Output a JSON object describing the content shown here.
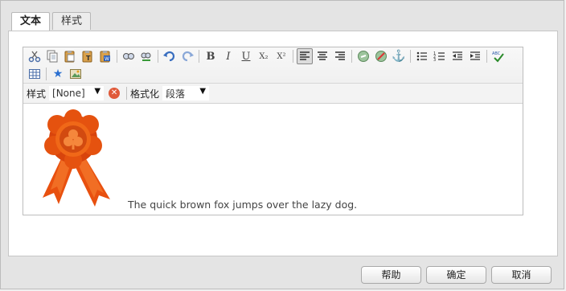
{
  "tabs": [
    {
      "label": "文本",
      "active": true
    },
    {
      "label": "样式",
      "active": false
    }
  ],
  "toolbar": {
    "row1": [
      {
        "icon": "cut-icon"
      },
      {
        "icon": "copy-icon"
      },
      {
        "icon": "paste-icon"
      },
      {
        "icon": "paste-text-icon"
      },
      {
        "icon": "paste-word-icon"
      },
      {
        "sep": true
      },
      {
        "icon": "find-icon"
      },
      {
        "icon": "replace-icon"
      },
      {
        "sep": true
      },
      {
        "icon": "undo-icon"
      },
      {
        "icon": "redo-icon"
      },
      {
        "sep": true
      },
      {
        "icon": "bold-icon",
        "glyph": "B"
      },
      {
        "icon": "italic-icon",
        "glyph": "I"
      },
      {
        "icon": "underline-icon",
        "glyph": "U"
      },
      {
        "icon": "subscript-icon",
        "glyph": "X₂"
      },
      {
        "icon": "superscript-icon",
        "glyph": "X²"
      },
      {
        "sep": true
      },
      {
        "icon": "align-left-icon",
        "pressed": true
      },
      {
        "icon": "align-center-icon"
      },
      {
        "icon": "align-right-icon"
      },
      {
        "sep": true
      },
      {
        "icon": "link-icon"
      },
      {
        "icon": "unlink-icon"
      },
      {
        "icon": "anchor-icon",
        "glyph": "⚓"
      },
      {
        "sep": true
      },
      {
        "icon": "bullet-list-icon"
      },
      {
        "icon": "numbered-list-icon"
      },
      {
        "icon": "outdent-icon"
      },
      {
        "icon": "indent-icon"
      },
      {
        "sep": true
      },
      {
        "icon": "spellcheck-icon"
      }
    ],
    "row2": [
      {
        "icon": "table-icon"
      },
      {
        "sep": true
      },
      {
        "icon": "special-char-icon",
        "glyph": "★"
      },
      {
        "icon": "image-icon"
      }
    ]
  },
  "format_bar": {
    "style_label": "样式",
    "style_value": "[None]",
    "format_label": "格式化",
    "format_value": "段落"
  },
  "content": {
    "image": "award-ribbon",
    "text": "The quick brown fox jumps over the lazy dog."
  },
  "footer": {
    "help_label": "帮助",
    "ok_label": "确定",
    "cancel_label": "取消"
  },
  "colors": {
    "ribbon_orange": "#f05a12",
    "ribbon_dark": "#c03d0a"
  }
}
